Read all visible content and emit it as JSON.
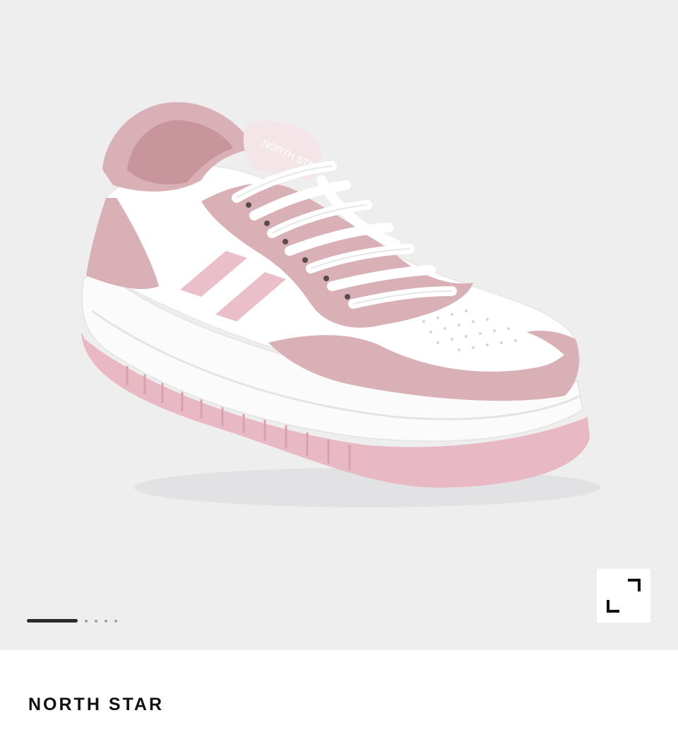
{
  "product": {
    "brand": "NORTH STAR",
    "image_description": "pink and white platform sneaker",
    "shoe_logo_text": "NORTH STAR"
  },
  "gallery": {
    "slide_count": 5,
    "active_slide": 1
  },
  "icons": {
    "expand": "expand-icon"
  },
  "colors": {
    "gallery_background": "#eeeeef",
    "pink": "#d9b0b6",
    "pink_dark": "#c9959d",
    "sole_pink": "#e8b9c4",
    "pager_active": "#2b2b2b"
  }
}
